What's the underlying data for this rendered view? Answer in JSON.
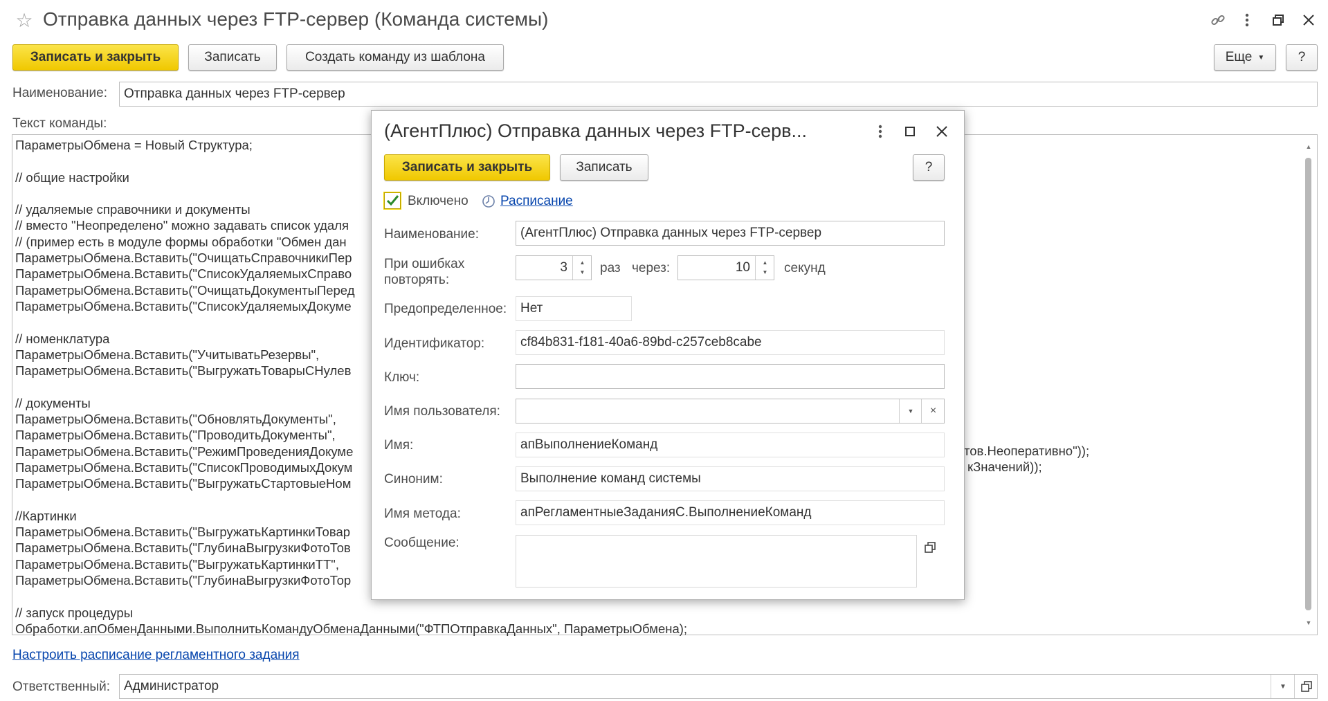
{
  "window": {
    "title": "Отправка данных через FTP-сервер (Команда системы)",
    "star_icon": "star-icon",
    "link_icon": "link-icon",
    "menu_icon": "kebab-menu-icon",
    "restore_icon": "restore-icon",
    "close_icon": "close-icon"
  },
  "toolbar": {
    "save_close": "Записать и закрыть",
    "save": "Записать",
    "create_from_template": "Создать команду из шаблона",
    "more": "Еще",
    "help": "?"
  },
  "form": {
    "name_label": "Наименование:",
    "name_value": "Отправка данных через FTP-сервер",
    "command_text_label": "Текст команды:",
    "code_left": [
      "ПараметрыОбмена = Новый Структура;",
      "",
      "// общие настройки",
      "",
      "// удаляемые справочники и документы",
      "// вместо \"Неопределено\" можно задавать список удаля",
      "// (пример есть в модуле формы обработки \"Обмен дан",
      "ПараметрыОбмена.Вставить(\"ОчищатьСправочникиПер",
      "ПараметрыОбмена.Вставить(\"СписокУдаляемыхСправо",
      "ПараметрыОбмена.Вставить(\"ОчищатьДокументыПеред",
      "ПараметрыОбмена.Вставить(\"СписокУдаляемыхДокуме",
      "",
      "// номенклатура",
      "ПараметрыОбмена.Вставить(\"УчитыватьРезервы\",",
      "ПараметрыОбмена.Вставить(\"ВыгружатьТоварыСНулев",
      "",
      "// документы",
      "ПараметрыОбмена.Вставить(\"ОбновлятьДокументы\",",
      "ПараметрыОбмена.Вставить(\"ПроводитьДокументы\",",
      "ПараметрыОбмена.Вставить(\"РежимПроведенияДокуме",
      "ПараметрыОбмена.Вставить(\"СписокПроводимыхДокум",
      "ПараметрыОбмена.Вставить(\"ВыгружатьСтартовыеНом",
      "",
      "//Картинки",
      "ПараметрыОбмена.Вставить(\"ВыгружатьКартинкиТовар",
      "ПараметрыОбмена.Вставить(\"ГлубинаВыгрузкиФотоТов",
      "ПараметрыОбмена.Вставить(\"ВыгружатьКартинкиТТ\",",
      "ПараметрыОбмена.Вставить(\"ГлубинаВыгрузкиФотоТор",
      "",
      "// запуск процедуры",
      "Обработки.апОбменДанными.ВыполнитьКомандуОбменаДанными(\"ФТПОтправкаДанных\", ПараметрыОбмена);"
    ],
    "code_right_1": "тов.Неоперативно\"));",
    "code_right_2": "кЗначений));",
    "schedule_link": "Настроить расписание регламентного задания",
    "responsible_label": "Ответственный:",
    "responsible_value": "Администратор"
  },
  "dialog": {
    "title": "(АгентПлюс) Отправка данных через FTP-серв...",
    "save_close": "Записать и закрыть",
    "save": "Записать",
    "help": "?",
    "enabled_label": "Включено",
    "enabled_checked": true,
    "schedule_link": "Расписание",
    "name_label": "Наименование:",
    "name_value": "(АгентПлюс) Отправка данных через FTP-сервер",
    "retry_label": "При ошибках повторять:",
    "retry_count": "3",
    "times_label": "раз",
    "through_label": "через:",
    "retry_interval": "10",
    "seconds_label": "секунд",
    "predefined_label": "Предопределенное:",
    "predefined_value": "Нет",
    "id_label": "Идентификатор:",
    "id_value": "cf84b831-f181-40a6-89bd-c257ceb8cabe",
    "key_label": "Ключ:",
    "key_value": "",
    "username_label": "Имя пользователя:",
    "username_value": "",
    "name2_label": "Имя:",
    "name2_value": "апВыполнениеКоманд",
    "synonym_label": "Синоним:",
    "synonym_value": "Выполнение команд системы",
    "method_label": "Имя метода:",
    "method_value": "апРегламентныеЗаданияС.ВыполнениеКоманд",
    "message_label": "Сообщение:",
    "message_value": ""
  }
}
